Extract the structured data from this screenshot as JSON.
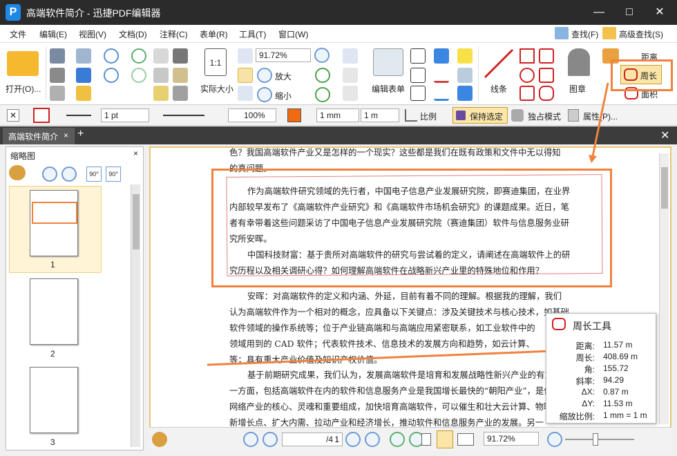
{
  "window": {
    "title": "高端软件简介 - 迅捷PDF编辑器",
    "logo_letter": "P"
  },
  "menu": [
    "文件",
    "编辑(E)",
    "视图(V)",
    "文档(D)",
    "注释(C)",
    "表单(R)",
    "工具(T)",
    "窗口(W)"
  ],
  "menu_right": {
    "find": "查找(F)",
    "advanced_find": "高级查找(S)"
  },
  "ribbon": {
    "open_label": "打开(O)...",
    "zoom_value": "91.72%",
    "actual_size": "实际大小",
    "zoom_in": "放大",
    "zoom_out": "缩小",
    "edit_form": "编辑表单",
    "line": "线条",
    "stamp": "图章",
    "distance": "距离",
    "perimeter": "周长",
    "area": "面积"
  },
  "toolbar2": {
    "line_width": "1 pt",
    "opacity": "100%",
    "unit_a": "1 mm",
    "unit_b": "1 m",
    "scale": "比例",
    "keep_selected": "保持选定",
    "exclusive": "独占模式",
    "properties": "属性(P)..."
  },
  "tab": {
    "label": "高端软件简介"
  },
  "thumbnails": {
    "title": "缩略图",
    "pages": [
      "1",
      "2",
      "3"
    ]
  },
  "document": {
    "line0": "色？我国高端软件产业又是怎样的一个现实？这些都是我们在既有政策和文件中无以得知\n的真问题。",
    "para1": "作为高端软件研究领域的先行者，中国电子信息产业发展研究院，即赛迪集团，在业界\n内部较早发布了《高端软件产业研究》和《高端软件市场机会研究》的课题成果。近日，笔\n者有幸带着这些问题采访了中国电子信息产业发展研究院（赛迪集团）软件与信息服务业研\n究所安晖。",
    "para2": "中国科技财富：基于贵所对高端软件的研究与尝试着的定义，请阐述在高端软件上的研\n究历程以及相关调研心得？如何理解高端软件在战略新兴产业里的特殊地位和作用？",
    "para3": "安晖：对高端软件的定义和内涵、外延，目前有着不同的理解。根据我的理解，我们\n认为高端软件作为一个相对的概念，应具备以下关键点：涉及关键技术与核心技术，如基础\n软件领域的操作系统等；位于产业链高端和与高端应用紧密联系，如工业软件中的\n领域用到的 CAD 软件；代表软件技术、信息技术的发展方向和趋势，如云计算、\n等；具有重大产业价值及知识产权价值。",
    "para4": "基于前期研究成果，我们认为，发展高端软件是培育和发展战略性新兴产业的有力抓手\n一方面，包括高端软件在内的软件和信息服务产业是我国增长最快的“朝阳产业”，是信息\n网络产业的核心、灵魂和重要组成，加快培育高端软件，可以催生和壮大云计算、物联网等\n新增长点、扩大内需、拉动产业和经济增长，推动软件和信息服务产业的发展。另一"
  },
  "popup": {
    "title": "周长工具",
    "rows": [
      {
        "k": "距离:",
        "v": "11.57 m"
      },
      {
        "k": "周长:",
        "v": "408.69 m"
      },
      {
        "k": "角:",
        "v": "155.72"
      },
      {
        "k": "斜率:",
        "v": "94.29"
      },
      {
        "k": "ΔX:",
        "v": "0.87 m"
      },
      {
        "k": "ΔY:",
        "v": "11.53 m"
      },
      {
        "k": "缩放比例:",
        "v": "1 mm = 1 m"
      }
    ]
  },
  "status": {
    "page_input": "1",
    "page_total": "/4",
    "zoom": "91.72%"
  },
  "colors": {
    "accent_orange": "#f0823c",
    "titlebar": "#2b2b2b",
    "highlight": "#e8c670"
  }
}
